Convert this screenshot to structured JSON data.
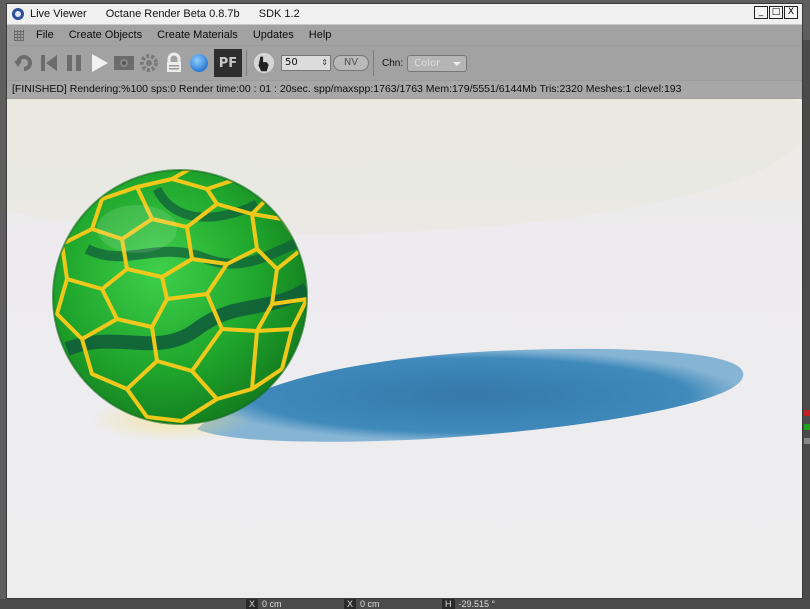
{
  "window": {
    "app_title": "Live Viewer",
    "product": "Octane Render Beta 0.8.7b",
    "sdk": "SDK 1.2",
    "controls": {
      "minimize": "_",
      "maximize": "□",
      "close": "X"
    }
  },
  "menu": [
    "File",
    "Create Objects",
    "Create Materials",
    "Updates",
    "Help"
  ],
  "toolbar": {
    "icons": [
      "restart-render-icon",
      "previous-icon",
      "pause-icon",
      "play-icon",
      "camera-icon",
      "settings-icon",
      "lock-icon",
      "sphere-icon"
    ],
    "pf_label": "PF",
    "spin_value": "50",
    "nv_label": "NV",
    "chn_label": "Chn:",
    "chn_value": "Color"
  },
  "status": {
    "text": "[FINISHED]  Rendering:%100 sps:0 Render time:00 : 01 : 20sec. spp/maxspp:1763/1763 Mem:179/5551/6144Mb Tris:2320 Meshes:1 clevel:193"
  },
  "footer": {
    "x1_key": "X",
    "x1_value": "0 cm",
    "x2_key": "X",
    "x2_value": "0 cm",
    "h_key": "H",
    "h_value": "-29.515 °"
  },
  "colors": {
    "shadow": "#3e86b8",
    "sphere": "#1f9a2e",
    "cells": "#e8c21a"
  }
}
